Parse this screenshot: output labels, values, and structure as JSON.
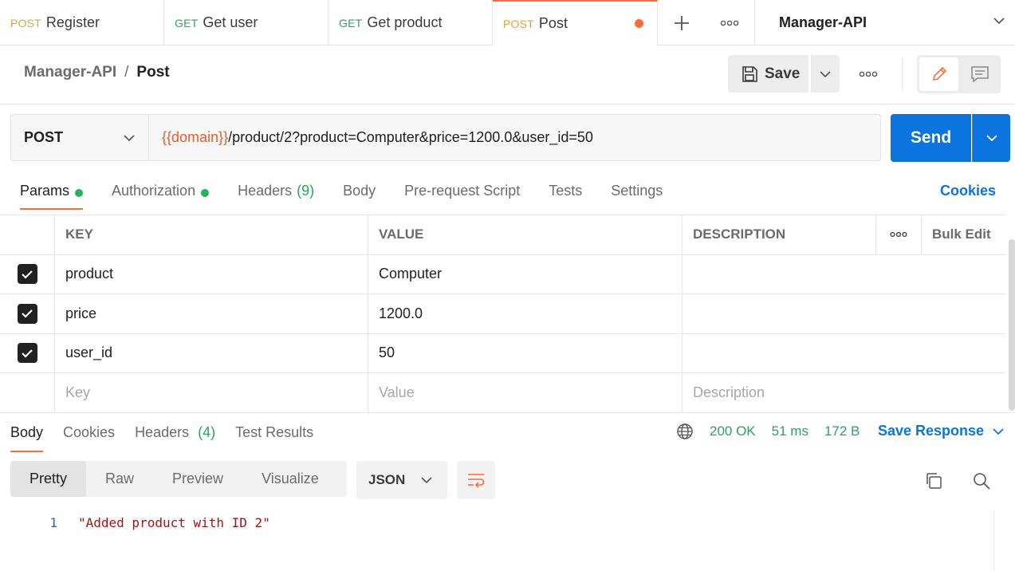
{
  "tabs": [
    {
      "method": "POST",
      "name": "Register"
    },
    {
      "method": "GET",
      "name": "Get user"
    },
    {
      "method": "GET",
      "name": "Get product"
    },
    {
      "method": "POST",
      "name": "Post"
    }
  ],
  "workspace": "Manager-API",
  "breadcrumb": {
    "parent": "Manager-API",
    "separator": "/",
    "current": "Post"
  },
  "save_label": "Save",
  "request": {
    "method": "POST",
    "url_variable": "{{domain}}",
    "url_rest": "/product/2?product=Computer&price=1200.0&user_id=50",
    "send_label": "Send"
  },
  "request_tabs": {
    "params": "Params",
    "authorization": "Authorization",
    "headers": "Headers",
    "headers_count": "(9)",
    "body": "Body",
    "prerequest": "Pre-request Script",
    "tests": "Tests",
    "settings": "Settings"
  },
  "cookies_label": "Cookies",
  "params_table": {
    "headers": {
      "key": "KEY",
      "value": "VALUE",
      "description": "DESCRIPTION",
      "bulk_edit": "Bulk Edit"
    },
    "rows": [
      {
        "key": "product",
        "value": "Computer"
      },
      {
        "key": "price",
        "value": "1200.0"
      },
      {
        "key": "user_id",
        "value": "50"
      }
    ],
    "placeholders": {
      "key": "Key",
      "value": "Value",
      "description": "Description"
    }
  },
  "response": {
    "tabs": {
      "body": "Body",
      "cookies": "Cookies",
      "headers": "Headers",
      "headers_count": "(4)",
      "test_results": "Test Results"
    },
    "status": "200 OK",
    "time": "51 ms",
    "size": "172 B",
    "save_response": "Save Response",
    "formats": {
      "pretty": "Pretty",
      "raw": "Raw",
      "preview": "Preview",
      "visualize": "Visualize"
    },
    "language": "JSON",
    "lines": [
      {
        "number": "1",
        "text": "\"Added product with ID 2\""
      }
    ]
  },
  "colors": {
    "accent": "#ff6c37",
    "primary": "#0b74de",
    "success": "#26a65b",
    "post_method": "#e0a23a",
    "get_method": "#26a65b"
  }
}
